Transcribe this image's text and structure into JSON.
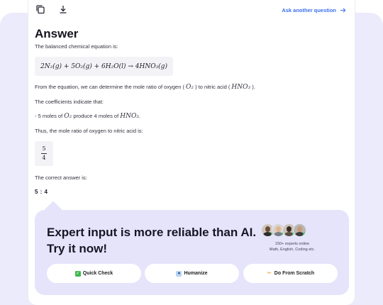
{
  "toolbar": {
    "ask_label": "Ask another question"
  },
  "answer": {
    "title": "Answer",
    "intro": "The balanced chemical equation is:",
    "equation": "2N₂(g) + 5O₂(g) + 6H₂O(l) → 4HNO₃(g)",
    "ratio_pre": "From the equation, we can determine the mole ratio of oxygen (",
    "ratio_o2": "O₂",
    "ratio_mid": ") to nitric acid (",
    "ratio_hno3": "HNO₃",
    "ratio_post": ").",
    "coeff": "The coefficients indicate that:",
    "moles_pre": "- 5 moles of",
    "moles_o2": "O₂",
    "moles_mid": "produce 4 moles of",
    "moles_hno3": "HNO₃",
    "moles_post": ".",
    "thus": "Thus, the mole ratio of oxygen to nitric acid is:",
    "frac_num": "5",
    "frac_den": "4",
    "correct": "The correct answer is:",
    "final": "5 : 4"
  },
  "promo": {
    "title": "Expert input is more reliable than AI. Try it now!",
    "experts_online": "150+ experts online",
    "subjects": "Math, English, Coding etc.",
    "buttons": [
      {
        "label": "Quick Check",
        "icon": "check-icon"
      },
      {
        "label": "Humanize",
        "icon": "person-icon"
      },
      {
        "label": "Do From Scratch",
        "icon": "pencil-icon"
      }
    ]
  },
  "colors": {
    "accent": "#3b6ff0",
    "promo_bg": "#e5e4fb",
    "page_bg": "#ecebfb"
  }
}
